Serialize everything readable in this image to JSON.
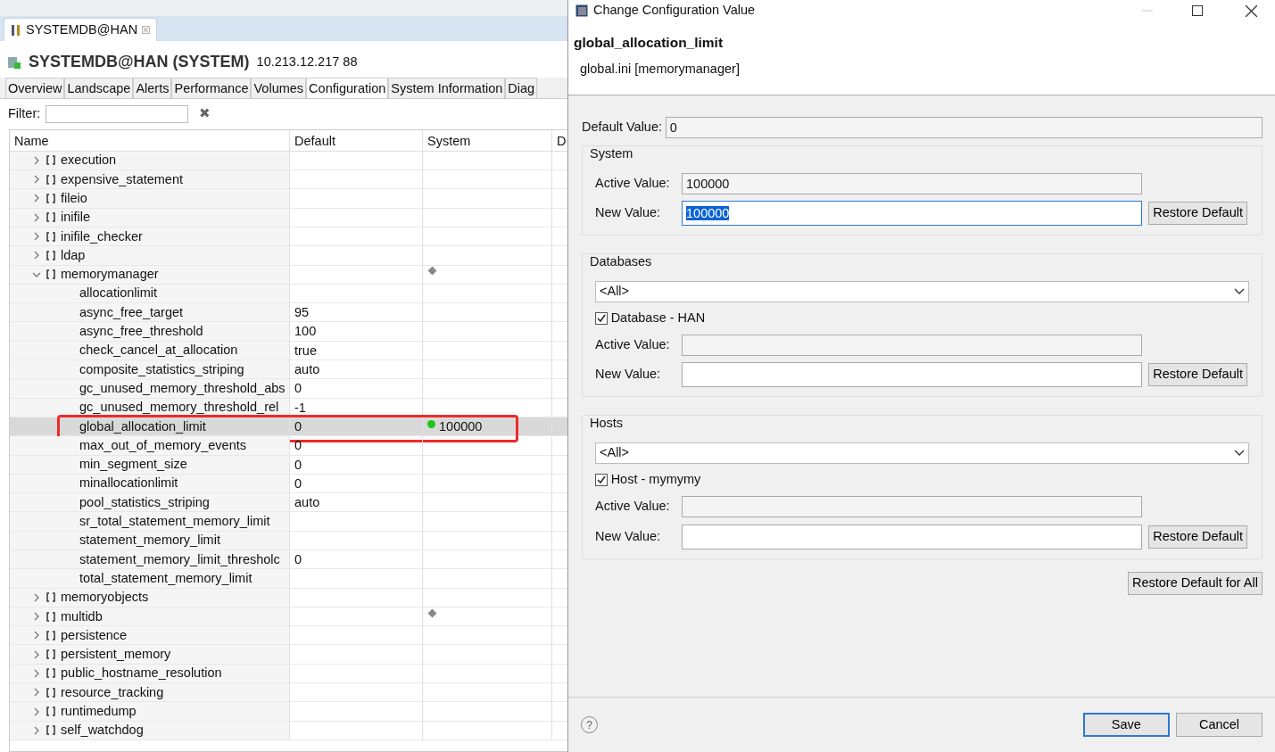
{
  "editor_tab": {
    "label": "SYSTEMDB@HAN",
    "close": "☒"
  },
  "heading": {
    "title": "SYSTEMDB@HAN (SYSTEM)",
    "address": "10.213.12.217 88"
  },
  "tabs": [
    {
      "label": "Overview",
      "selected": false
    },
    {
      "label": "Landscape",
      "selected": false
    },
    {
      "label": "Alerts",
      "selected": false
    },
    {
      "label": "Performance",
      "selected": false
    },
    {
      "label": "Volumes",
      "selected": false
    },
    {
      "label": "Configuration",
      "selected": true
    },
    {
      "label": "System Information",
      "selected": false
    },
    {
      "label": "Diag",
      "selected": false
    }
  ],
  "filter": {
    "label": "Filter:",
    "clear": "✖"
  },
  "table": {
    "columns": [
      "Name",
      "Default",
      "System",
      "D"
    ],
    "rows": [
      {
        "name": "execution",
        "expanded": false,
        "selected": false
      },
      {
        "name": "expensive_statement",
        "expanded": false,
        "selected": false
      },
      {
        "name": "fileio",
        "expanded": false,
        "selected": false
      },
      {
        "name": "inifile",
        "expanded": false,
        "selected": false
      },
      {
        "name": "inifile_checker",
        "expanded": false,
        "selected": false
      },
      {
        "name": "ldap",
        "expanded": false,
        "selected": false
      },
      {
        "name": "memorymanager",
        "expanded": true,
        "selected": false,
        "marker": {
          "kind": "diamond"
        },
        "children": [
          {
            "name": "allocationlimit",
            "selected": false
          },
          {
            "name": "async_free_target",
            "default": "95",
            "selected": false
          },
          {
            "name": "async_free_threshold",
            "default": "100",
            "selected": false
          },
          {
            "name": "check_cancel_at_allocation",
            "default": "true",
            "selected": false
          },
          {
            "name": "composite_statistics_striping",
            "default": "auto",
            "selected": false
          },
          {
            "name": "gc_unused_memory_threshold_abs",
            "default": "0",
            "selected": false
          },
          {
            "name": "gc_unused_memory_threshold_rel",
            "default": "-1",
            "selected": false
          },
          {
            "name": "global_allocation_limit",
            "default": "0",
            "system": "100000",
            "marker": {
              "kind": "dot"
            },
            "selected": true,
            "outlined": true
          },
          {
            "name": "max_out_of_memory_events",
            "default": "0",
            "selected": false
          },
          {
            "name": "min_segment_size",
            "default": "0",
            "selected": false
          },
          {
            "name": "minallocationlimit",
            "default": "0",
            "selected": false
          },
          {
            "name": "pool_statistics_striping",
            "default": "auto",
            "selected": false
          },
          {
            "name": "sr_total_statement_memory_limit",
            "selected": false
          },
          {
            "name": "statement_memory_limit",
            "selected": false
          },
          {
            "name": "statement_memory_limit_thresholc",
            "default": "0",
            "selected": false
          },
          {
            "name": "total_statement_memory_limit",
            "selected": false
          }
        ]
      },
      {
        "name": "memoryobjects",
        "expanded": false,
        "selected": false
      },
      {
        "name": "multidb",
        "expanded": false,
        "selected": false,
        "marker": {
          "kind": "diamond"
        }
      },
      {
        "name": "persistence",
        "expanded": false,
        "selected": false
      },
      {
        "name": "persistent_memory",
        "expanded": false,
        "selected": false
      },
      {
        "name": "public_hostname_resolution",
        "expanded": false,
        "selected": false
      },
      {
        "name": "resource_tracking",
        "expanded": false,
        "selected": false
      },
      {
        "name": "runtimedump",
        "expanded": false,
        "selected": false
      },
      {
        "name": "self_watchdog",
        "expanded": false,
        "selected": false
      }
    ]
  },
  "dialog": {
    "title": "Change Configuration Value",
    "parameter": "global_allocation_limit",
    "file": "global.ini [memorymanager]",
    "default_label": "Default Value:",
    "default_value": "0",
    "sections": [
      {
        "title": "System",
        "active_label": "Active Value:",
        "active_value": "100000",
        "new_label": "New Value:",
        "new_value": "100000",
        "new_selected": true,
        "restore": "Restore Default"
      },
      {
        "title": "Databases",
        "dropdown": "<All>",
        "check_label": "Database - HAN",
        "checked": true,
        "active_label": "Active Value:",
        "new_label": "New Value:",
        "restore": "Restore Default"
      },
      {
        "title": "Hosts",
        "dropdown": "<All>",
        "check_label": "Host - mymymy",
        "checked": true,
        "active_label": "Active Value:",
        "new_label": "New Value:",
        "restore": "Restore Default"
      }
    ],
    "restore_all": "Restore Default for All",
    "help": "?",
    "buttons": [
      {
        "label": "Save",
        "primary": true
      },
      {
        "label": "Cancel",
        "primary": false
      }
    ]
  }
}
